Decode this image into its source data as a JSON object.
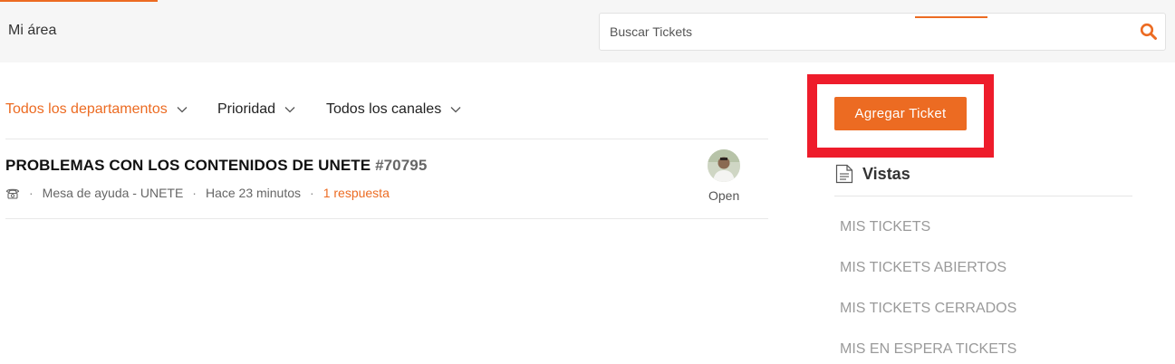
{
  "header": {
    "title": "Mi área",
    "search": {
      "placeholder": "Buscar Tickets",
      "value": "",
      "icon": "search-icon"
    }
  },
  "filters": [
    {
      "label": "Todos los departamentos",
      "active": true
    },
    {
      "label": "Prioridad",
      "active": false
    },
    {
      "label": "Todos los canales",
      "active": false
    }
  ],
  "tickets": [
    {
      "title": "PROBLEMAS CON LOS CONTENIDOS DE UNETE",
      "id": "#70795",
      "channel_icon": "phone-icon",
      "department": "Mesa de ayuda - UNETE",
      "time": "Hace 23 minutos",
      "replies": "1 respuesta",
      "status": "Open"
    }
  ],
  "sidebar": {
    "add_ticket_label": "Agregar Ticket",
    "views_title": "Vistas",
    "views": [
      "MIS TICKETS",
      "MIS TICKETS ABIERTOS",
      "MIS TICKETS CERRADOS",
      "MIS EN ESPERA TICKETS"
    ]
  },
  "colors": {
    "accent": "#ec6b22",
    "highlight": "#ee1c2b",
    "header_bg": "#f6f6f6"
  }
}
